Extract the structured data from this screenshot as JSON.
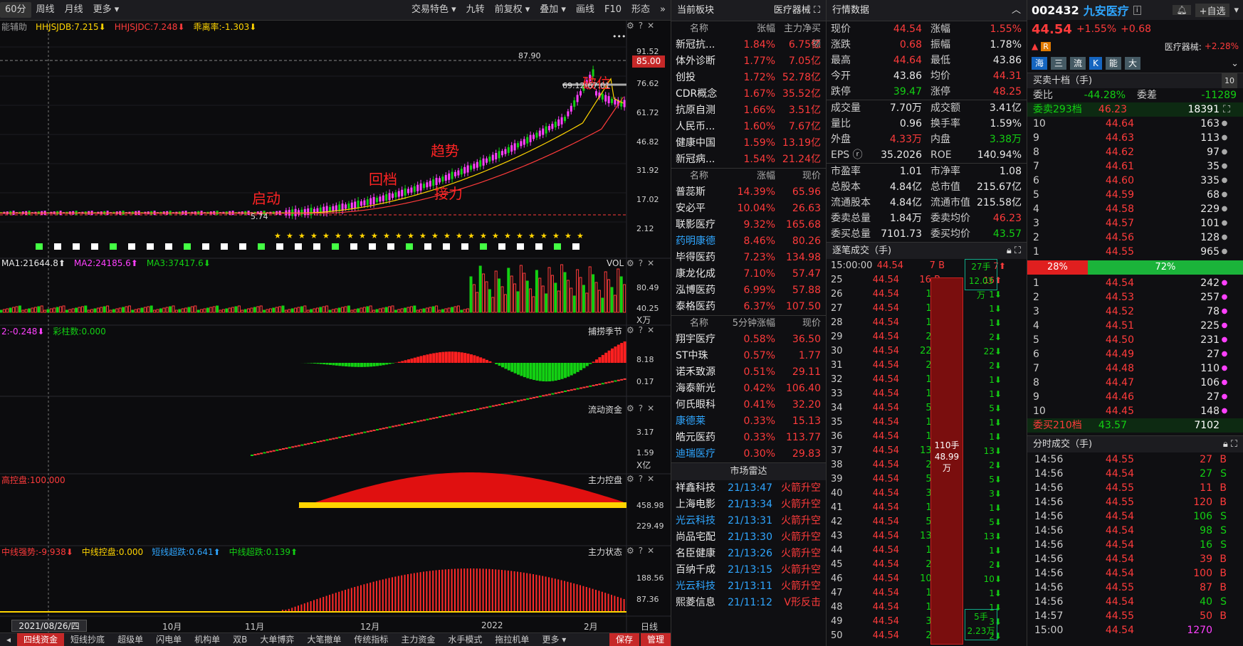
{
  "toolbar": {
    "items": [
      "60分",
      "周线",
      "月线",
      "更多 ▾"
    ],
    "right": [
      "交易特色 ▾",
      "九转",
      "前复权 ▾",
      "叠加 ▾",
      "画线",
      "F10",
      "形态"
    ]
  },
  "chart": {
    "main_header": [
      {
        "t": "能辅助",
        "c": "gy"
      },
      {
        "t": "HHJSJDB:7.215⬇",
        "c": "y"
      },
      {
        "t": "HHJSJDC:7.248⬇",
        "c": "r"
      },
      {
        "t": "乖离率:-1.303⬇",
        "c": "y"
      }
    ],
    "main_ylabels": [
      "91.52",
      "76.62",
      "61.72",
      "46.82",
      "31.92",
      "17.02",
      "2.12"
    ],
    "price_tag": "85.00",
    "annotations": [
      "启动",
      "回档",
      "趋势",
      "接力",
      "破位"
    ],
    "high_label": "87.90",
    "low_label": "5.74",
    "range_label": "69.12-67.01",
    "vol_header": [
      {
        "t": "MA1:21644.8⬆",
        "c": "w"
      },
      {
        "t": "MA2:24185.6⬆",
        "c": "m"
      },
      {
        "t": "MA3:37417.6⬇",
        "c": "g"
      }
    ],
    "vol_title": "VOL",
    "vol_ylabels": [
      "80.49",
      "40.25"
    ],
    "vol_unit": "X万",
    "p3_header": [
      {
        "t": "2:-0.248⬇",
        "c": "m"
      },
      {
        "t": "彩柱数:0.000",
        "c": "g"
      }
    ],
    "p3_title": "捕捞季节",
    "p3_ylabels": [
      "8.18",
      "0.17"
    ],
    "p4_title": "流动资金",
    "p4_ylabels": [
      "3.17",
      "1.59"
    ],
    "p4_unit": "X亿",
    "p5_header": [
      {
        "t": "高控盘:100.000",
        "c": "r"
      }
    ],
    "p5_title": "主力控盘",
    "p5_ylabels": [
      "458.98",
      "229.49"
    ],
    "p6_header": [
      {
        "t": "中线强势:-9.938⬇",
        "c": "r"
      },
      {
        "t": "中线控盘:0.000",
        "c": "y"
      },
      {
        "t": "短线超跌:0.641⬆",
        "c": "b"
      },
      {
        "t": "中线超跌:0.139⬆",
        "c": "g"
      }
    ],
    "p6_title": "主力状态",
    "p6_ylabels": [
      "188.56",
      "87.36"
    ],
    "date_box": "2021/08/26/四",
    "x_labels": [
      "10月",
      "11月",
      "12月",
      "2022",
      "2月"
    ],
    "period": "日线"
  },
  "bottombar": [
    "四线资金",
    "短线抄底",
    "超级单",
    "闪电单",
    "机构单",
    "双B",
    "大单博弈",
    "大笔撤单",
    "传统指标",
    "主力资金",
    "水手模式",
    "拖拉机单",
    "更多 ▾"
  ],
  "bottom_right": [
    "保存",
    "管理"
  ],
  "sectors": {
    "title": "当前板块",
    "tag": "医疗器械",
    "header": [
      "名称",
      "张幅",
      "主力净买额"
    ],
    "rows": [
      [
        "新冠抗...",
        "1.84%",
        "6.75亿"
      ],
      [
        "体外诊断",
        "1.77%",
        "7.05亿"
      ],
      [
        "创投",
        "1.72%",
        "52.78亿"
      ],
      [
        "CDR概念",
        "1.67%",
        "35.52亿"
      ],
      [
        "抗原自测",
        "1.66%",
        "3.51亿"
      ],
      [
        "人民币...",
        "1.60%",
        "7.67亿"
      ],
      [
        "健康中国",
        "1.59%",
        "13.19亿"
      ],
      [
        "新冠病...",
        "1.54%",
        "21.24亿"
      ]
    ],
    "header2": [
      "名称",
      "涨幅",
      "现价"
    ],
    "rows2": [
      [
        "普蕊斯",
        "14.39%",
        "65.96",
        "w"
      ],
      [
        "安必平",
        "10.04%",
        "26.63",
        "w"
      ],
      [
        "联影医疗",
        "9.32%",
        "165.68",
        "w"
      ],
      [
        "药明康德",
        "8.46%",
        "80.26",
        "b"
      ],
      [
        "毕得医药",
        "7.23%",
        "134.98",
        "w"
      ],
      [
        "康龙化成",
        "7.10%",
        "57.47",
        "w"
      ],
      [
        "泓博医药",
        "6.99%",
        "57.88",
        "w"
      ],
      [
        "泰格医药",
        "6.37%",
        "107.50",
        "w"
      ]
    ],
    "header3": [
      "名称",
      "5分钟涨幅",
      "现价"
    ],
    "rows3": [
      [
        "翔宇医疗",
        "0.58%",
        "36.50",
        "w"
      ],
      [
        "ST中珠",
        "0.57%",
        "1.77",
        "w"
      ],
      [
        "诺禾致源",
        "0.51%",
        "29.11",
        "w"
      ],
      [
        "海泰新光",
        "0.42%",
        "106.40",
        "w"
      ],
      [
        "何氏眼科",
        "0.41%",
        "32.20",
        "w"
      ],
      [
        "康德莱",
        "0.33%",
        "15.13",
        "b"
      ],
      [
        "皓元医药",
        "0.33%",
        "113.77",
        "w"
      ],
      [
        "迪瑞医疗",
        "0.30%",
        "29.83",
        "b"
      ]
    ],
    "radar_title": "市场雷达",
    "radar": [
      [
        "祥鑫科技",
        "21/13:47",
        "火箭升空",
        "w"
      ],
      [
        "上海电影",
        "21/13:34",
        "火箭升空",
        "w"
      ],
      [
        "光云科技",
        "21/13:31",
        "火箭升空",
        "b"
      ],
      [
        "尚品宅配",
        "21/13:30",
        "火箭升空",
        "w"
      ],
      [
        "名臣健康",
        "21/13:26",
        "火箭升空",
        "w"
      ],
      [
        "百纳千成",
        "21/13:15",
        "火箭升空",
        "w"
      ],
      [
        "光云科技",
        "21/13:11",
        "火箭升空",
        "b"
      ],
      [
        "熙菱信息",
        "21/11:12",
        "V形反击",
        "w"
      ]
    ]
  },
  "quote": {
    "title": "行情数据",
    "rows": [
      [
        "现价",
        "44.54",
        "r",
        "涨幅",
        "1.55%",
        "r"
      ],
      [
        "涨跌",
        "0.68",
        "r",
        "振幅",
        "1.78%",
        "w"
      ],
      [
        "最高",
        "44.64",
        "r",
        "最低",
        "43.86",
        "w"
      ],
      [
        "今开",
        "43.86",
        "w",
        "均价",
        "44.31",
        "r"
      ],
      [
        "跌停",
        "39.47",
        "g",
        "涨停",
        "48.25",
        "r"
      ]
    ],
    "rows2": [
      [
        "成交量",
        "7.70万",
        "w",
        "成交额",
        "3.41亿",
        "w"
      ],
      [
        "量比",
        "0.96",
        "w",
        "换手率",
        "1.59%",
        "w"
      ],
      [
        "外盘",
        "4.33万",
        "r",
        "内盘",
        "3.38万",
        "g"
      ],
      [
        "EPS ⓡ",
        "35.2026",
        "w",
        "ROE",
        "140.94%",
        "w"
      ]
    ],
    "rows3": [
      [
        "市盈率",
        "1.01",
        "w",
        "市净率",
        "1.08",
        "w"
      ],
      [
        "总股本",
        "4.84亿",
        "w",
        "总市值",
        "215.67亿",
        "w"
      ],
      [
        "流通股本",
        "4.84亿",
        "w",
        "流通市值",
        "215.58亿",
        "w"
      ],
      [
        "委卖总量",
        "1.84万",
        "w",
        "委卖均价",
        "46.23",
        "r"
      ],
      [
        "委买总量",
        "7101.73",
        "w",
        "委买均价",
        "43.57",
        "g"
      ]
    ],
    "ticks_title": "逐笔成交（手)",
    "ticks": [
      [
        "15:00:00",
        "44.54",
        "7 B",
        "7⬆"
      ],
      [
        "25",
        "44.54",
        "16 B",
        "16⬆"
      ],
      [
        "26",
        "44.54",
        "1 S",
        "1⬇"
      ],
      [
        "27",
        "44.54",
        "1 S",
        "1⬇"
      ],
      [
        "28",
        "44.54",
        "1 S",
        "1⬇"
      ],
      [
        "29",
        "44.54",
        "2 S",
        "2⬇"
      ],
      [
        "30",
        "44.54",
        "22 S",
        "22⬇"
      ],
      [
        "31",
        "44.54",
        "2 S",
        "2⬇"
      ],
      [
        "32",
        "44.54",
        "1 S",
        "1⬇"
      ],
      [
        "33",
        "44.54",
        "1 S",
        "1⬇"
      ],
      [
        "34",
        "44.54",
        "5 S",
        "5⬇"
      ],
      [
        "35",
        "44.54",
        "1 S",
        "1⬇"
      ],
      [
        "36",
        "44.54",
        "1 S",
        "1⬇"
      ],
      [
        "37",
        "44.54",
        "13 S",
        "13⬇"
      ],
      [
        "38",
        "44.54",
        "2 S",
        "2⬇"
      ],
      [
        "39",
        "44.54",
        "5 S",
        "5⬇"
      ],
      [
        "40",
        "44.54",
        "3 S",
        "3⬇"
      ],
      [
        "41",
        "44.54",
        "1 S",
        "1⬇"
      ],
      [
        "42",
        "44.54",
        "5 S",
        "5⬇"
      ],
      [
        "43",
        "44.54",
        "13 S",
        "13⬇"
      ],
      [
        "44",
        "44.54",
        "1 S",
        "1⬇"
      ],
      [
        "45",
        "44.54",
        "2 S",
        "2⬇"
      ],
      [
        "46",
        "44.54",
        "10 S",
        "10⬇"
      ],
      [
        "47",
        "44.54",
        "1 S",
        "1⬇"
      ],
      [
        "48",
        "44.54",
        "1 S",
        "1⬇"
      ],
      [
        "49",
        "44.54",
        "3 S",
        "3⬇"
      ],
      [
        "50",
        "44.54",
        "2 S",
        "2⬇"
      ]
    ],
    "agg_top": [
      "27手",
      "12.03万"
    ],
    "agg_mid": [
      "110手",
      "48.99万"
    ],
    "agg_bot": [
      "5手",
      "2.23万"
    ]
  },
  "stock": {
    "code": "002432",
    "name": "九安医疗",
    "price": "44.54",
    "chg_pct": "+1.55%",
    "chg": "+0.68",
    "watch": "+自选",
    "sector": "医疗器械:",
    "sector_chg": "+2.28%",
    "tags": [
      "海",
      "三",
      "流",
      "K",
      "能",
      "大"
    ],
    "ob_title": "买卖十档（手)",
    "ob_num": "10",
    "weibi_lbl": "委比",
    "weibi": "-44.28%",
    "weicha_lbl": "委差",
    "weicha": "-11289",
    "sell_total_lbl": "委卖293档",
    "sell_total_p": "46.23",
    "sell_total_q": "18391",
    "asks": [
      [
        "10",
        "44.64",
        "163"
      ],
      [
        "9",
        "44.63",
        "113"
      ],
      [
        "8",
        "44.62",
        "97"
      ],
      [
        "7",
        "44.61",
        "35"
      ],
      [
        "6",
        "44.60",
        "335"
      ],
      [
        "5",
        "44.59",
        "68"
      ],
      [
        "4",
        "44.58",
        "229"
      ],
      [
        "3",
        "44.57",
        "101"
      ],
      [
        "2",
        "44.56",
        "128"
      ],
      [
        "1",
        "44.55",
        "965"
      ]
    ],
    "ratio": [
      "28%",
      "72%"
    ],
    "bids": [
      [
        "1",
        "44.54",
        "242"
      ],
      [
        "2",
        "44.53",
        "257"
      ],
      [
        "3",
        "44.52",
        "78"
      ],
      [
        "4",
        "44.51",
        "225"
      ],
      [
        "5",
        "44.50",
        "231"
      ],
      [
        "6",
        "44.49",
        "27"
      ],
      [
        "7",
        "44.48",
        "110"
      ],
      [
        "8",
        "44.47",
        "106"
      ],
      [
        "9",
        "44.46",
        "27"
      ],
      [
        "10",
        "44.45",
        "148"
      ]
    ],
    "buy_total_lbl": "委买210档",
    "buy_total_p": "43.57",
    "buy_total_q": "7102",
    "trades_title": "分时成交（手)",
    "trades": [
      [
        "14:56",
        "44.55",
        "27",
        "B"
      ],
      [
        "14:56",
        "44.54",
        "27",
        "S"
      ],
      [
        "14:56",
        "44.55",
        "11",
        "B"
      ],
      [
        "14:56",
        "44.55",
        "120",
        "B"
      ],
      [
        "14:56",
        "44.54",
        "106",
        "S"
      ],
      [
        "14:56",
        "44.54",
        "98",
        "S"
      ],
      [
        "14:56",
        "44.54",
        "16",
        "S"
      ],
      [
        "14:56",
        "44.54",
        "39",
        "B"
      ],
      [
        "14:56",
        "44.54",
        "100",
        "B"
      ],
      [
        "14:56",
        "44.55",
        "87",
        "B"
      ],
      [
        "14:56",
        "44.54",
        "40",
        "S"
      ],
      [
        "14:57",
        "44.55",
        "50",
        "B"
      ],
      [
        "15:00",
        "44.54",
        "1270",
        ""
      ]
    ]
  }
}
